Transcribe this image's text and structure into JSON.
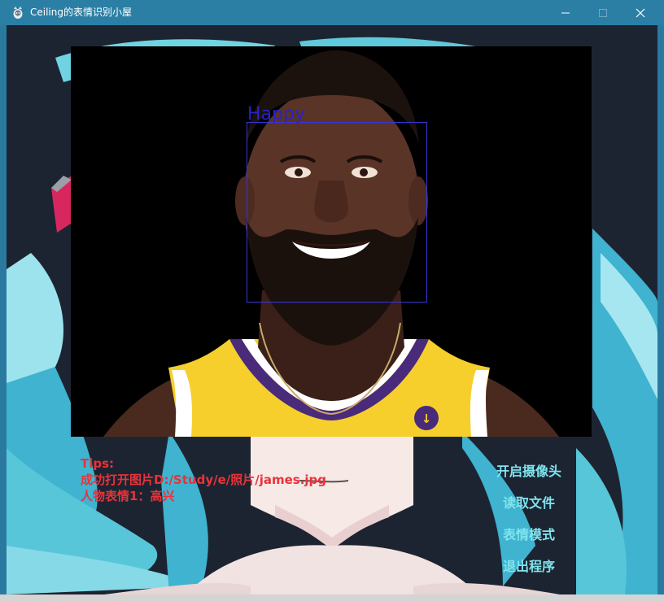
{
  "window": {
    "title": "Ceiling的表情识别小屋",
    "controls": {
      "minimize_icon": "minimize-icon",
      "maximize_icon": "maximize-icon",
      "close_icon": "close-icon"
    },
    "title_bar_color": "#2b7fa5"
  },
  "image_panel": {
    "detection": {
      "label": "Happy",
      "box_color": "#3b35d6"
    }
  },
  "tips": {
    "heading": "Tips:",
    "line1": "成功打开图片D:/Study/e/照片/james.jpg",
    "line2": "人物表情1：高兴",
    "color": "#e8333a"
  },
  "menu": {
    "camera": "开启摄像头",
    "file": "读取文件",
    "mode": "表情模式",
    "exit": "退出程序",
    "color": "#7fe4ee"
  }
}
